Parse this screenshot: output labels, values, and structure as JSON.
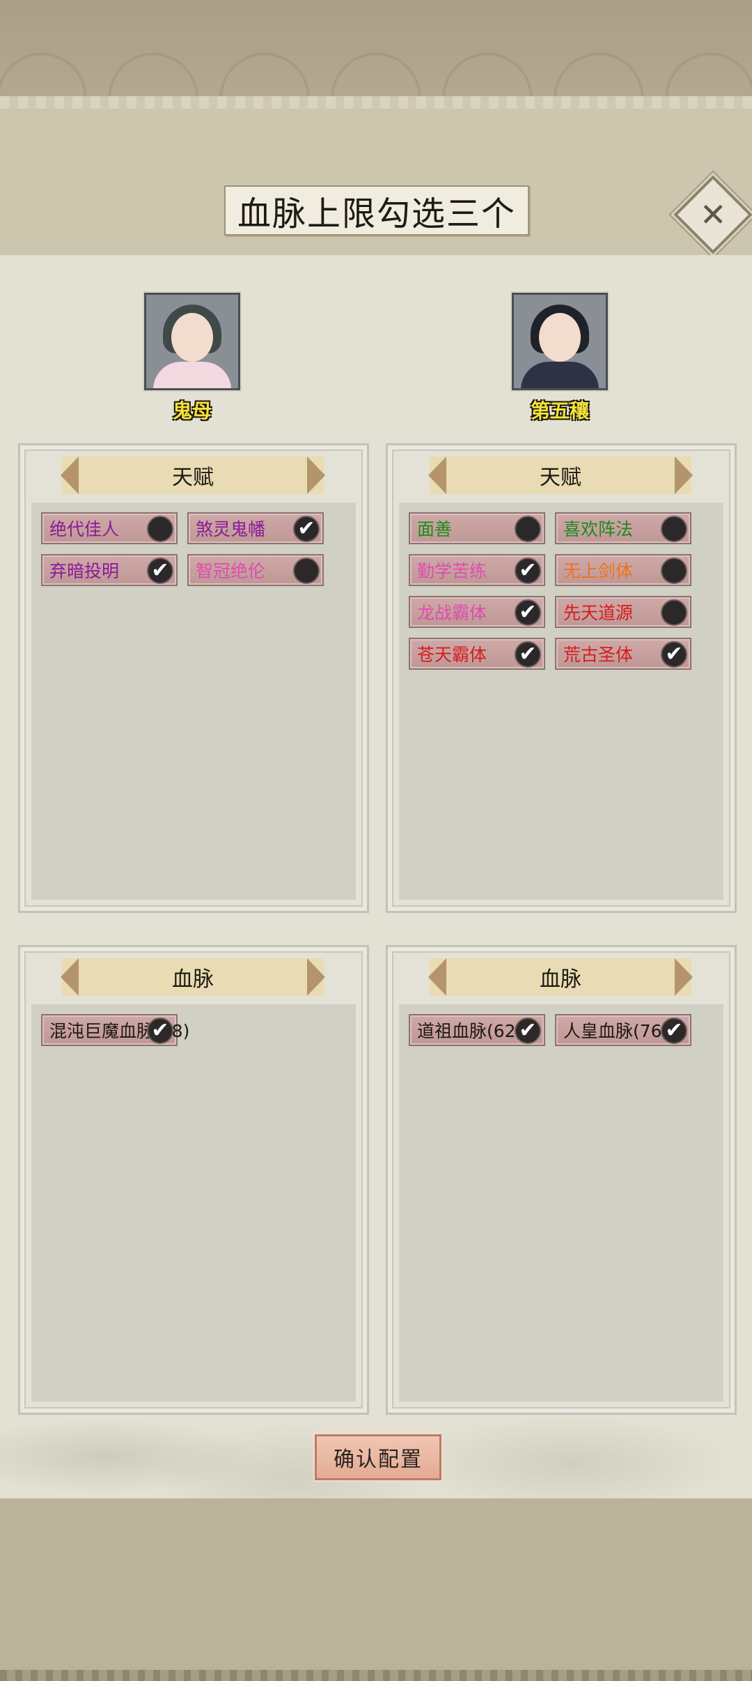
{
  "title": "血脉上限勾选三个",
  "close_icon": "close-x-icon",
  "characters": [
    {
      "name": "鬼母",
      "talent_header": "天赋",
      "bloodline_header": "血脉",
      "talents": [
        {
          "label": "绝代佳人",
          "color": "#8a1a9a",
          "checked": false
        },
        {
          "label": "煞灵鬼幡",
          "color": "#8a1a9a",
          "checked": true
        },
        {
          "label": "弃暗投明",
          "color": "#8a1a9a",
          "checked": true
        },
        {
          "label": "智冠绝伦",
          "color": "#e04bb0",
          "checked": false
        }
      ],
      "bloodlines": [
        {
          "label": "混沌巨魔血脉(68)",
          "color": "#1c1912",
          "checked": true
        }
      ]
    },
    {
      "name": "第五穰",
      "talent_header": "天赋",
      "bloodline_header": "血脉",
      "talents": [
        {
          "label": "面善",
          "color": "#1a8a1a",
          "checked": false
        },
        {
          "label": "喜欢阵法",
          "color": "#1a8a1a",
          "checked": false
        },
        {
          "label": "勤学苦练",
          "color": "#e04bb0",
          "checked": true
        },
        {
          "label": "无上剑体",
          "color": "#f0721c",
          "checked": false
        },
        {
          "label": "龙战霸体",
          "color": "#e04bb0",
          "checked": true
        },
        {
          "label": "先天道源",
          "color": "#d81c1c",
          "checked": false
        },
        {
          "label": "苍天霸体",
          "color": "#d81c1c",
          "checked": true
        },
        {
          "label": "荒古圣体",
          "color": "#d81c1c",
          "checked": true
        }
      ],
      "bloodlines": [
        {
          "label": "道祖血脉(62)",
          "color": "#1c1912",
          "checked": true
        },
        {
          "label": "人皇血脉(76)",
          "color": "#1c1912",
          "checked": true
        }
      ]
    }
  ],
  "confirm_label": "确认配置",
  "check_glyph": "✔"
}
